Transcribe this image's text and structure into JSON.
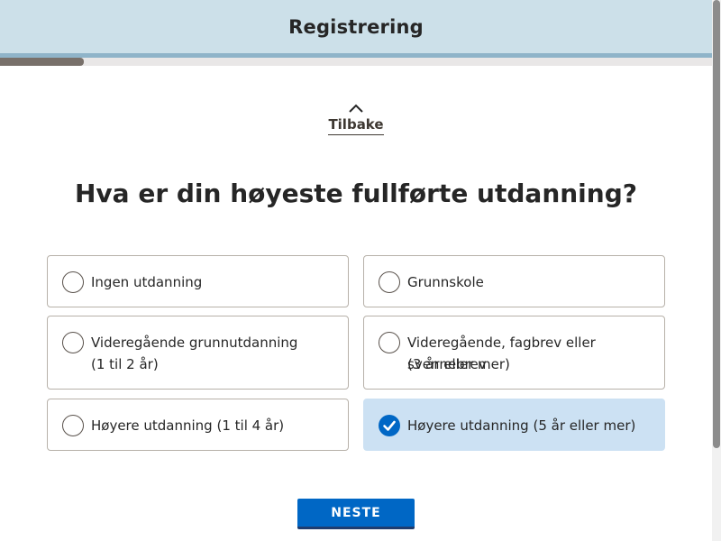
{
  "header": {
    "title": "Registrering"
  },
  "progress": {
    "fraction": 0.118
  },
  "back": {
    "label": "Tilbake"
  },
  "question": "Hva er din høyeste fullførte utdanning?",
  "options": [
    {
      "line1": "Ingen utdanning",
      "line2": "",
      "selected": false
    },
    {
      "line1": "Grunnskole",
      "line2": "",
      "selected": false
    },
    {
      "line1": "Videregående grunnutdanning",
      "line2": "(1 til 2 år)",
      "selected": false
    },
    {
      "line1": "Videregående, fagbrev eller svennebrev",
      "line2": "(3 år eller mer)",
      "selected": false
    },
    {
      "line1": "Høyere utdanning (1 til 4 år)",
      "line2": "",
      "selected": false
    },
    {
      "line1": "Høyere utdanning (5 år eller mer)",
      "line2": "",
      "selected": true
    }
  ],
  "next_button": {
    "label": "NESTE"
  },
  "colors": {
    "accent": "#0067c5",
    "header_bg": "#cce0e9",
    "selected_bg": "#cce1f3"
  }
}
